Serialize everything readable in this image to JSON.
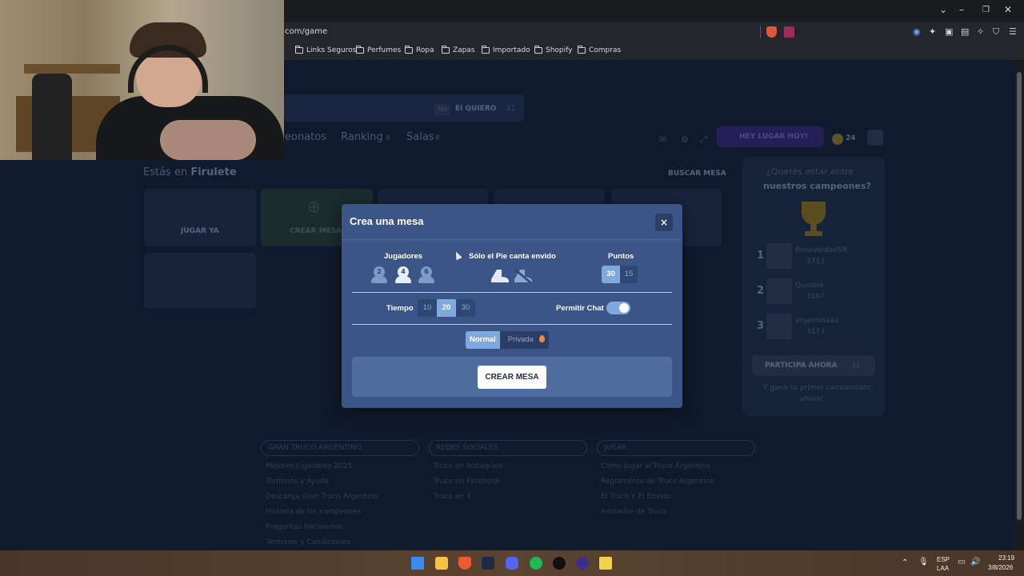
{
  "browser": {
    "url": "com/game",
    "bookmarks": [
      "Links Seguros",
      "Perfumes",
      "Ropa",
      "Zapas",
      "Importado",
      "Shopify",
      "Compras"
    ]
  },
  "background": {
    "nav_items": [
      "eonatos",
      "Ranking",
      "Salas"
    ],
    "nav_counts": [
      "8",
      "8"
    ],
    "location_prefix": "Estás en",
    "location_name": "Firulete",
    "search_table": "BUSCAR MESA",
    "banner_text": "El QUIERO",
    "banner_count": "11",
    "banner_tag": "No",
    "cta_label": "HEY LUGAR HOY!",
    "coin_count": "24",
    "play_label": "JUGAR YA",
    "create_label": "CREAR MESA",
    "side_title_1": "¿Querés estar entre",
    "side_title_2": "nuestros campeones?",
    "participate": "PARTICIPA AHORA",
    "participate_count": "11",
    "side_footer_1": "Y gana tu primer campeonato",
    "side_footer_2": "ahora!",
    "ranks": [
      {
        "num": "1",
        "name": "RosaVerdadSR",
        "score": "3713"
      },
      {
        "num": "2",
        "name": "Quessie",
        "score": "3167"
      },
      {
        "num": "3",
        "name": "argentinaaa",
        "score": "3173"
      }
    ],
    "footer_columns": [
      {
        "title": "GRAN TRUCO ARGENTINO",
        "links": [
          "Mejores Jugadores 2025",
          "Términos y Ayuda",
          "Descarga Gran Truco Argentino",
          "Historia de los campeones",
          "Preguntas frecuentes",
          "Términos y Condiciones"
        ]
      },
      {
        "title": "REDES SOCIALES",
        "links": [
          "Truco en Instagram",
          "Truco en Facebook",
          "Truco en X"
        ]
      },
      {
        "title": "JUGAR",
        "links": [
          "Cómo jugar al Truco Argentino",
          "Reglamento de Truco Argentino",
          "El Truco Y El Envido",
          "Anotador de Truco"
        ]
      }
    ]
  },
  "modal": {
    "title": "Crea una mesa",
    "close": "×",
    "players_label": "Jugadores",
    "players_options": [
      "2",
      "4",
      "6"
    ],
    "players_selected": "4",
    "pie_label": "Sólo el Pie canta envido",
    "points_label": "Puntos",
    "points_options": [
      "30",
      "15"
    ],
    "points_selected": "30",
    "time_label": "Tiempo",
    "time_options": [
      "10",
      "20",
      "30"
    ],
    "time_selected": "20",
    "chat_label": "Permitir Chat",
    "chat_enabled": true,
    "mode_options": [
      "Normal",
      "Privada"
    ],
    "mode_selected": "Normal",
    "create_button": "CREAR MESA"
  },
  "taskbar": {
    "lang_1": "ESP",
    "lang_2": "LAA",
    "time": "23:19",
    "date": "3/8/2026"
  },
  "colors": {
    "modal_bg": "#3a5586",
    "accent": "#7fa8de",
    "page_bg": "#101a2e"
  }
}
